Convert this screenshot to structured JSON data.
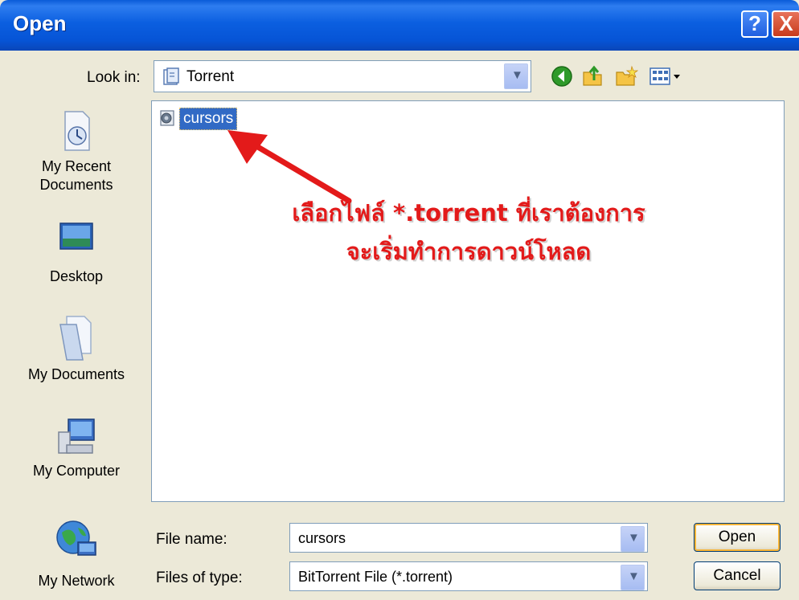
{
  "window": {
    "title": "Open",
    "help_label": "?",
    "close_label": "X"
  },
  "look_in": {
    "label": "Look in:",
    "value": "Torrent"
  },
  "toolbar": {
    "icons": [
      "back-icon",
      "up-folder-icon",
      "new-folder-icon",
      "view-menu-icon"
    ]
  },
  "places": [
    {
      "label": "My Recent Documents",
      "icon": "recent-documents-icon"
    },
    {
      "label": "Desktop",
      "icon": "desktop-icon"
    },
    {
      "label": "My Documents",
      "icon": "my-documents-icon"
    },
    {
      "label": "My Computer",
      "icon": "my-computer-icon"
    },
    {
      "label": "My Network",
      "icon": "my-network-icon"
    }
  ],
  "file_list": {
    "items": [
      {
        "name": "cursors",
        "selected": true
      }
    ],
    "annotation": {
      "line1": "เลือกไฟล์ *.torrent ที่เราต้องการ",
      "line2": "จะเริ่มทำการดาวน์โหลด",
      "color": "#e31a1a"
    }
  },
  "file_name": {
    "label": "File name:",
    "value": "cursors"
  },
  "file_type": {
    "label": "Files of type:",
    "value": "BitTorrent File (*.torrent)"
  },
  "buttons": {
    "open": "Open",
    "cancel": "Cancel"
  },
  "colors": {
    "titlebar": "#0654d6",
    "selection": "#316ac5",
    "dialog_bg": "#ece9d8"
  }
}
